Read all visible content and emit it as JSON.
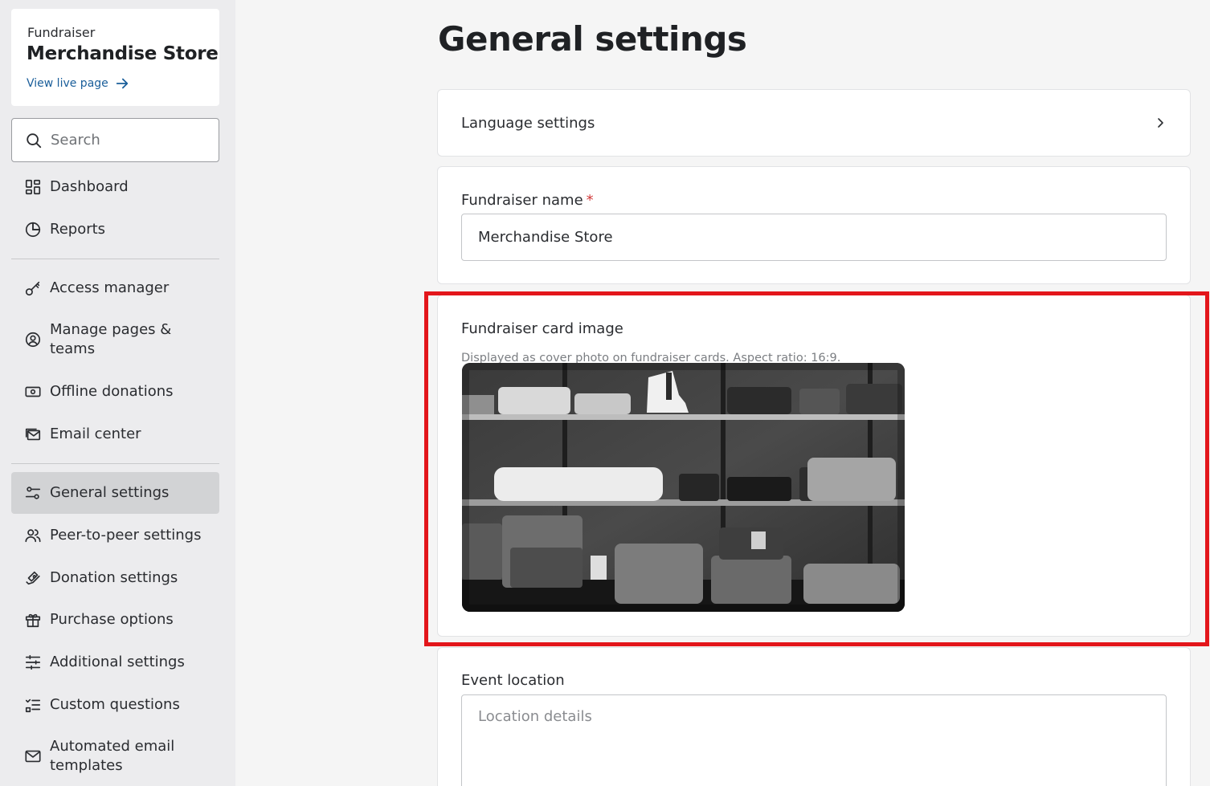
{
  "sidebar": {
    "brand": {
      "subtitle": "Fundraiser",
      "title": "Merchandise Store",
      "link": "View live page"
    },
    "search": {
      "placeholder": "Search"
    },
    "items": [
      {
        "label": "Dashboard",
        "icon": "dashboard-icon"
      },
      {
        "label": "Reports",
        "icon": "reports-pie-icon"
      },
      {
        "label": "Access manager",
        "icon": "key-icon"
      },
      {
        "label": "Manage pages & teams",
        "icon": "user-circle-icon"
      },
      {
        "label": "Offline donations",
        "icon": "cash-icon"
      },
      {
        "label": "Email center",
        "icon": "email-stack-icon"
      },
      {
        "label": "General settings",
        "icon": "sliders-icon",
        "active": true
      },
      {
        "label": "Peer-to-peer settings",
        "icon": "people-icon"
      },
      {
        "label": "Donation settings",
        "icon": "hand-heart-icon"
      },
      {
        "label": "Purchase options",
        "icon": "gift-icon"
      },
      {
        "label": "Additional settings",
        "icon": "adjustments-icon"
      },
      {
        "label": "Custom questions",
        "icon": "checklist-icon"
      },
      {
        "label": "Automated email templates",
        "icon": "envelope-icon"
      }
    ]
  },
  "main": {
    "title": "General settings",
    "language_settings": "Language settings",
    "fundraiser_name": {
      "label": "Fundraiser name",
      "required_mark": "*",
      "value": "Merchandise Store"
    },
    "card_image": {
      "label": "Fundraiser card image",
      "hint": "Displayed as cover photo on fundraiser cards. Aspect ratio: 16:9."
    },
    "event_location": {
      "label": "Event location",
      "placeholder": "Location details"
    }
  },
  "colors": {
    "highlight": "#e3161b",
    "link": "#1a5e9a",
    "active_nav": "#d2d3d5"
  }
}
